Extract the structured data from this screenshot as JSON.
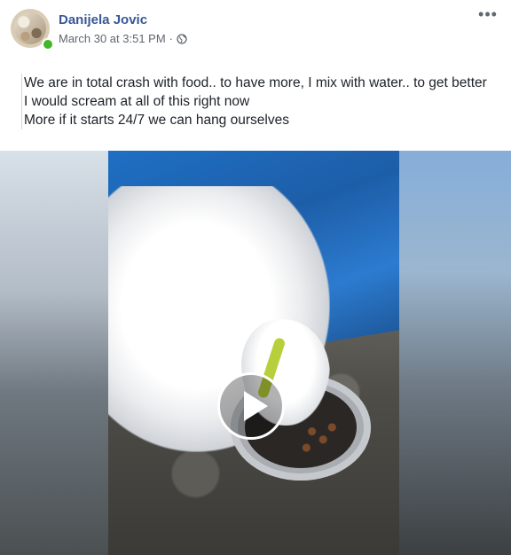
{
  "post": {
    "author": "Danijela Jovic",
    "timestamp": "March 30 at 3:51 PM",
    "separator": "·",
    "privacy_icon": "globe-icon",
    "more_icon": "more-options-icon",
    "more_label": "•••",
    "online_status": true,
    "text_lines": [
      "We are in total crash with food.. to have more, I mix with water.. to get better",
      "I would scream at all of this right now",
      "More if it starts 24/7 we can hang ourselves"
    ]
  },
  "video": {
    "play_icon": "play-icon"
  },
  "colors": {
    "author_link": "#385898",
    "meta_text": "#616770",
    "body_text": "#1d2129",
    "online_dot": "#42b72a"
  }
}
